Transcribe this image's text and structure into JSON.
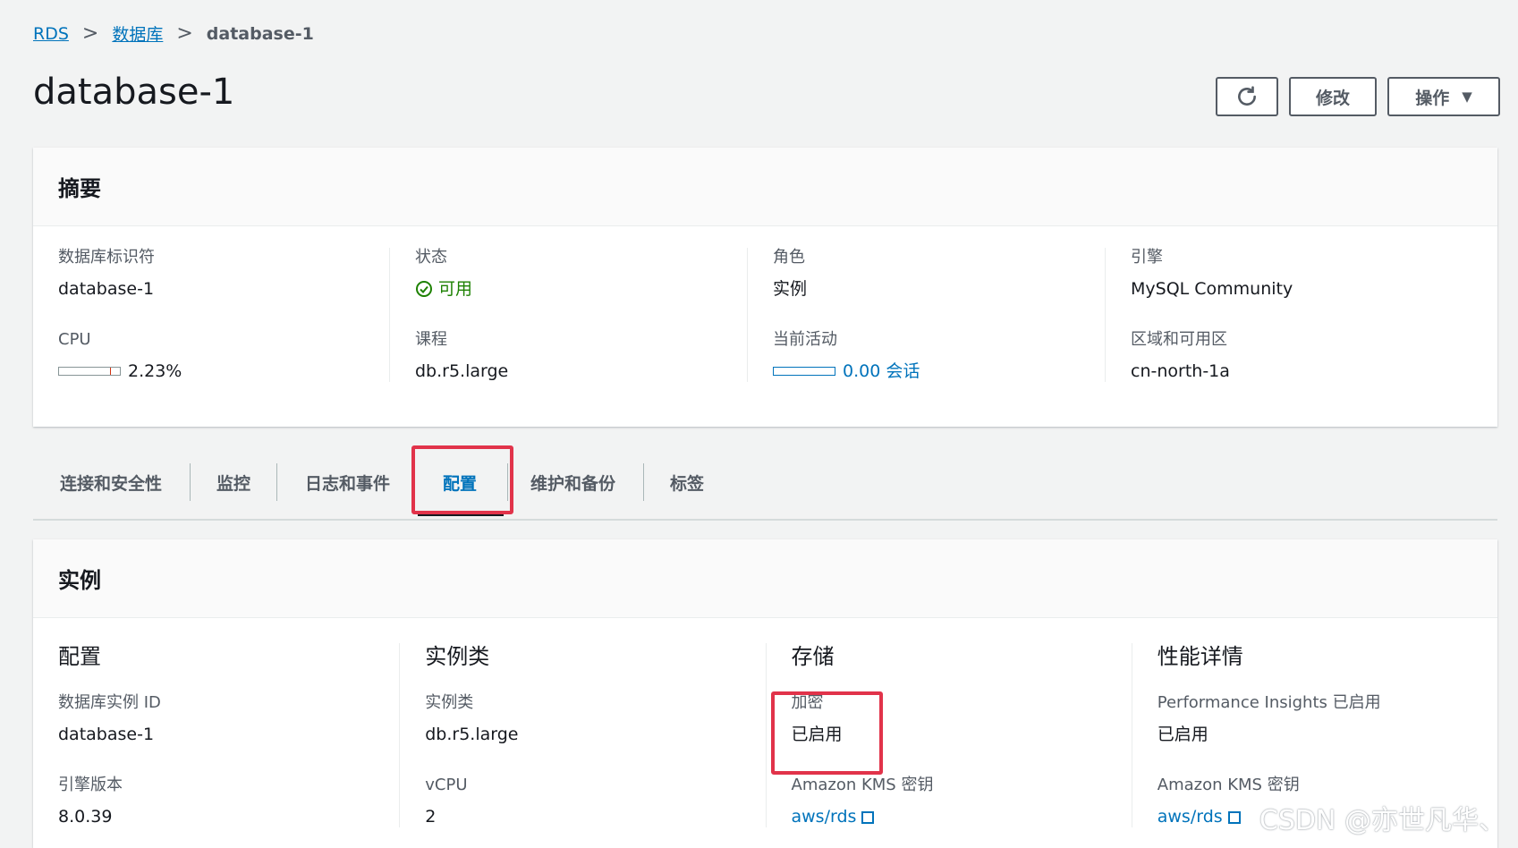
{
  "breadcrumb": {
    "rds": "RDS",
    "databases": "数据库",
    "current": "database-1",
    "sep": ">"
  },
  "title": "database-1",
  "actions": {
    "modify": "修改",
    "operations": "操作",
    "refresh_icon": "refresh-icon",
    "dropdown_icon": "caret-down-icon",
    "caret": "▼"
  },
  "summary": {
    "heading": "摘要",
    "db_identifier_label": "数据库标识符",
    "db_identifier": "database-1",
    "cpu_label": "CPU",
    "cpu_value": "2.23%",
    "cpu_fraction": 0.0223,
    "status_label": "状态",
    "status_value": "可用",
    "class_label": "课程",
    "class_value": "db.r5.large",
    "role_label": "角色",
    "role_value": "实例",
    "activity_label": "当前活动",
    "activity_value": "0.00 会话",
    "engine_label": "引擎",
    "engine_value": "MySQL Community",
    "region_label": "区域和可用区",
    "region_value": "cn-north-1a"
  },
  "tabs": [
    "连接和安全性",
    "监控",
    "日志和事件",
    "配置",
    "维护和备份",
    "标签"
  ],
  "active_tab": "配置",
  "instance": {
    "heading": "实例",
    "config": {
      "title": "配置",
      "id_label": "数据库实例 ID",
      "id_value": "database-1",
      "engine_version_label": "引擎版本",
      "engine_version": "8.0.39"
    },
    "instance_class": {
      "title": "实例类",
      "class_label": "实例类",
      "class_value": "db.r5.large",
      "vcpu_label": "vCPU",
      "vcpu_value": "2"
    },
    "storage": {
      "title": "存储",
      "encryption_label": "加密",
      "encryption_value": "已启用",
      "kms_label": "Amazon KMS 密钥",
      "kms_value": "aws/rds"
    },
    "performance": {
      "title": "性能详情",
      "pi_label": "Performance Insights 已启用",
      "pi_value": "已启用",
      "kms_label": "Amazon KMS 密钥",
      "kms_value": "aws/rds"
    }
  },
  "watermark": "CSDN @亦世凡华、",
  "colors": {
    "link": "#0073bb",
    "success": "#1d8102",
    "highlight": "#e1334a"
  }
}
